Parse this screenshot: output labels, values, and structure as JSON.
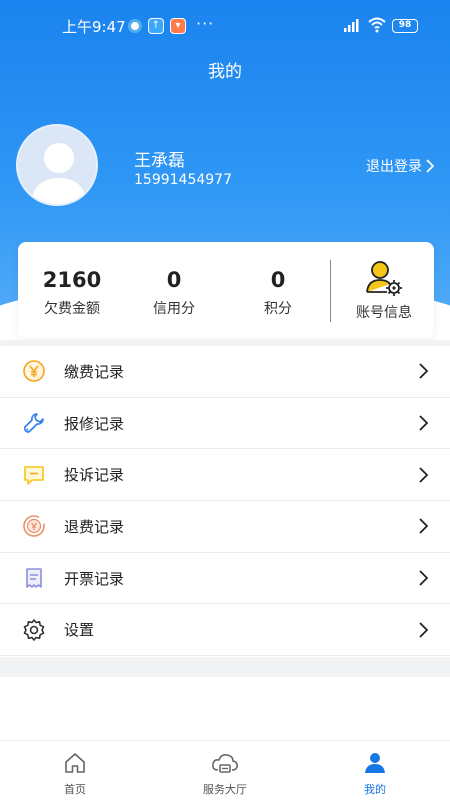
{
  "status_bar": {
    "time": "上午9:47",
    "more": "···",
    "battery": "98",
    "app_icons": [
      "message-app-icon",
      "upload-app-icon",
      "store-app-icon"
    ]
  },
  "header": {
    "title": "我的"
  },
  "profile": {
    "name": "王承磊",
    "phone": "15991454977",
    "logout_label": "退出登录"
  },
  "stats": [
    {
      "value": "2160",
      "label": "欠费金额"
    },
    {
      "value": "0",
      "label": "信用分"
    },
    {
      "value": "0",
      "label": "积分"
    }
  ],
  "account": {
    "label": "账号信息",
    "icon": "user-gear-icon"
  },
  "menu": [
    {
      "label": "缴费记录",
      "icon": "yen-coin-icon",
      "color": "#f5a623"
    },
    {
      "label": "报修记录",
      "icon": "wrench-icon",
      "color": "#2f80ed"
    },
    {
      "label": "投诉记录",
      "icon": "chat-bubble-icon",
      "color": "#f5c518"
    },
    {
      "label": "退费记录",
      "icon": "refund-icon",
      "color": "#e8906a"
    },
    {
      "label": "开票记录",
      "icon": "receipt-icon",
      "color": "#8e8ee0"
    },
    {
      "label": "设置",
      "icon": "settings-gear-icon",
      "color": "#333333"
    }
  ],
  "tabs": [
    {
      "label": "首页",
      "icon": "home-icon",
      "active": false
    },
    {
      "label": "服务大厅",
      "icon": "cloud-service-icon",
      "active": false
    },
    {
      "label": "我的",
      "icon": "person-icon",
      "active": true
    }
  ],
  "colors": {
    "primary": "#1a83ee",
    "active_tab": "#1677e6"
  }
}
